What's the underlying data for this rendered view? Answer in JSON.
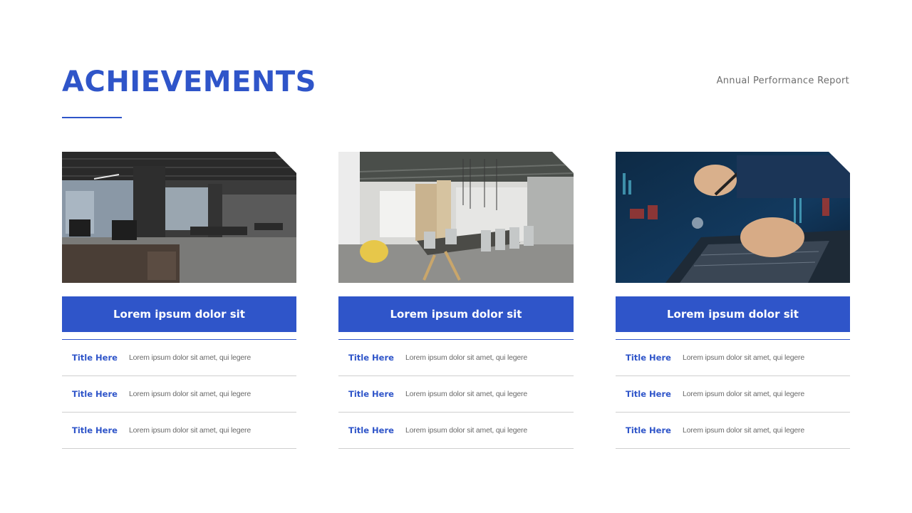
{
  "header": {
    "title": "ACHIEVEMENTS",
    "subtitle": "Annual Performance Report"
  },
  "colors": {
    "accent": "#2f55c9",
    "text_muted": "#6a6a6a",
    "divider": "#cfcfcf"
  },
  "cards": [
    {
      "image": "dark-office-interior-photo",
      "heading": "Lorem ipsum dolor sit",
      "rows": [
        {
          "title": "Title Here",
          "text": "Lorem ipsum dolor sit amet, qui legere"
        },
        {
          "title": "Title Here",
          "text": "Lorem ipsum dolor sit amet, qui legere"
        },
        {
          "title": "Title Here",
          "text": "Lorem ipsum dolor sit amet, qui legere"
        }
      ]
    },
    {
      "image": "meeting-room-photo",
      "heading": "Lorem ipsum dolor sit",
      "rows": [
        {
          "title": "Title Here",
          "text": "Lorem ipsum dolor sit amet, qui legere"
        },
        {
          "title": "Title Here",
          "text": "Lorem ipsum dolor sit amet, qui legere"
        },
        {
          "title": "Title Here",
          "text": "Lorem ipsum dolor sit amet, qui legere"
        }
      ]
    },
    {
      "image": "laptop-analytics-photo",
      "heading": "Lorem ipsum dolor sit",
      "rows": [
        {
          "title": "Title Here",
          "text": "Lorem ipsum dolor sit amet, qui legere"
        },
        {
          "title": "Title Here",
          "text": "Lorem ipsum dolor sit amet, qui legere"
        },
        {
          "title": "Title Here",
          "text": "Lorem ipsum dolor sit amet, qui legere"
        }
      ]
    }
  ]
}
